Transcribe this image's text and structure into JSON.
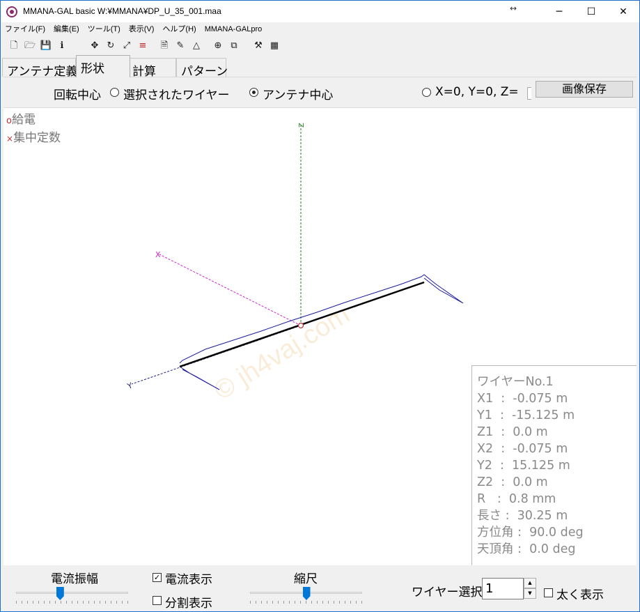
{
  "window": {
    "title": "MMANA-GAL basic W:¥MMANA¥DP_U_35_001.maa",
    "resize_glyph": "↔",
    "minimize_glyph": "─",
    "maximize_glyph": "☐",
    "close_glyph": "✕"
  },
  "menu": [
    "ファイル(F)",
    "編集(E)",
    "ツール(T)",
    "表示(V)",
    "ヘルプ(H)",
    "MMANA-GALpro"
  ],
  "toolbar": {
    "icons": [
      "new-file-icon",
      "open-folder-icon",
      "save-icon",
      "info-icon",
      "move-icon",
      "rotate-icon",
      "resize-icon",
      "wire-edit-icon",
      "document-icon",
      "pen-icon",
      "triangle-icon",
      "target-icon",
      "copy-icon",
      "tools-icon",
      "calculator-icon"
    ],
    "glyphs": [
      "🗋",
      "🗁",
      "💾",
      "ℹ",
      "✥",
      "↻",
      "⤢",
      "≡",
      "🗎",
      "✎",
      "△",
      "⊕",
      "⧉",
      "⚒",
      "▦"
    ]
  },
  "tabs": [
    {
      "label": "アンテナ定義",
      "active": false
    },
    {
      "label": "形状",
      "active": true
    },
    {
      "label": "計算",
      "active": false
    },
    {
      "label": "パターン",
      "active": false
    }
  ],
  "rotation": {
    "label": "回転中心",
    "options": [
      {
        "label": "選択されたワイヤー",
        "checked": false
      },
      {
        "label": "アンテナ中心",
        "checked": true
      },
      {
        "label": "X=0, Y=0, Z=",
        "checked": false
      }
    ],
    "save_image_button": "画像保存"
  },
  "legend": {
    "feed_mark": "o",
    "feed_label": "給電",
    "load_mark": "×",
    "load_label": "集中定数"
  },
  "axes": {
    "x_label": "X",
    "y_label": "Y",
    "z_label": "Z"
  },
  "colors": {
    "x_axis": "#d020d0",
    "y_axis": "#202080",
    "z_axis": "#208020",
    "wire": "#000000",
    "current": "#1a1aa0",
    "feed": "#c03030"
  },
  "watermark": "© jh4vaj.com",
  "wire_info": {
    "title": "ワイヤーNo.1",
    "rows": [
      "X1  :  -0.075 m",
      "Y1  :  -15.125 m",
      "Z1  :  0.0 m",
      "X2  :  -0.075 m",
      "Y2  :  15.125 m",
      "Z2  :  0.0 m",
      "R   :  0.8 mm",
      "長さ :  30.25 m",
      "方位角 :  90.0 deg",
      "天頂角 :  0.0 deg"
    ]
  },
  "bottom": {
    "current_amplitude_label": "電流振幅",
    "current_amplitude_level": 0.39,
    "show_current_label": "電流表示",
    "show_current_checked": true,
    "show_segments_label": "分割表示",
    "show_segments_checked": false,
    "scale_label": "縮尺",
    "scale_level": 0.5,
    "wire_select_label": "ワイヤー選択",
    "wire_select_value": "1",
    "bold_label": "太く表示",
    "bold_checked": false
  }
}
